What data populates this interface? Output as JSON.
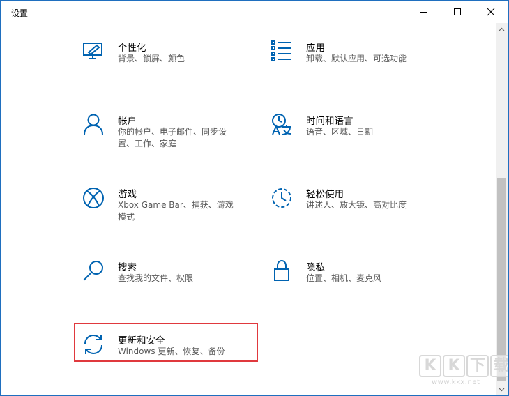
{
  "window": {
    "title": "设置"
  },
  "colors": {
    "accent": "#0063b1",
    "highlight_border": "#e0393e",
    "description": "#5a5a5a"
  },
  "items": [
    {
      "key": "personalization",
      "icon": "personalization-icon",
      "title": "个性化",
      "desc": "背景、锁屏、颜色"
    },
    {
      "key": "apps",
      "icon": "apps-list-icon",
      "title": "应用",
      "desc": "卸载、默认应用、可选功能"
    },
    {
      "key": "accounts",
      "icon": "person-icon",
      "title": "帐户",
      "desc": "你的帐户、电子邮件、同步设置、工作、家庭"
    },
    {
      "key": "time-language",
      "icon": "time-language-icon",
      "title": "时间和语言",
      "desc": "语音、区域、日期"
    },
    {
      "key": "gaming",
      "icon": "xbox-icon",
      "title": "游戏",
      "desc": "Xbox Game Bar、捕获、游戏模式"
    },
    {
      "key": "ease-of-access",
      "icon": "ease-of-access-icon",
      "title": "轻松使用",
      "desc": "讲述人、放大镜、高对比度"
    },
    {
      "key": "search",
      "icon": "magnifier-icon",
      "title": "搜索",
      "desc": "查找我的文件、权限"
    },
    {
      "key": "privacy",
      "icon": "lock-icon",
      "title": "隐私",
      "desc": "位置、相机、麦克风"
    },
    {
      "key": "update-security",
      "icon": "sync-icon",
      "title": "更新和安全",
      "desc": "Windows 更新、恢复、备份"
    }
  ],
  "watermark": {
    "letters": [
      "K",
      "K",
      "下",
      "载"
    ],
    "url": "www.kkx.net"
  }
}
